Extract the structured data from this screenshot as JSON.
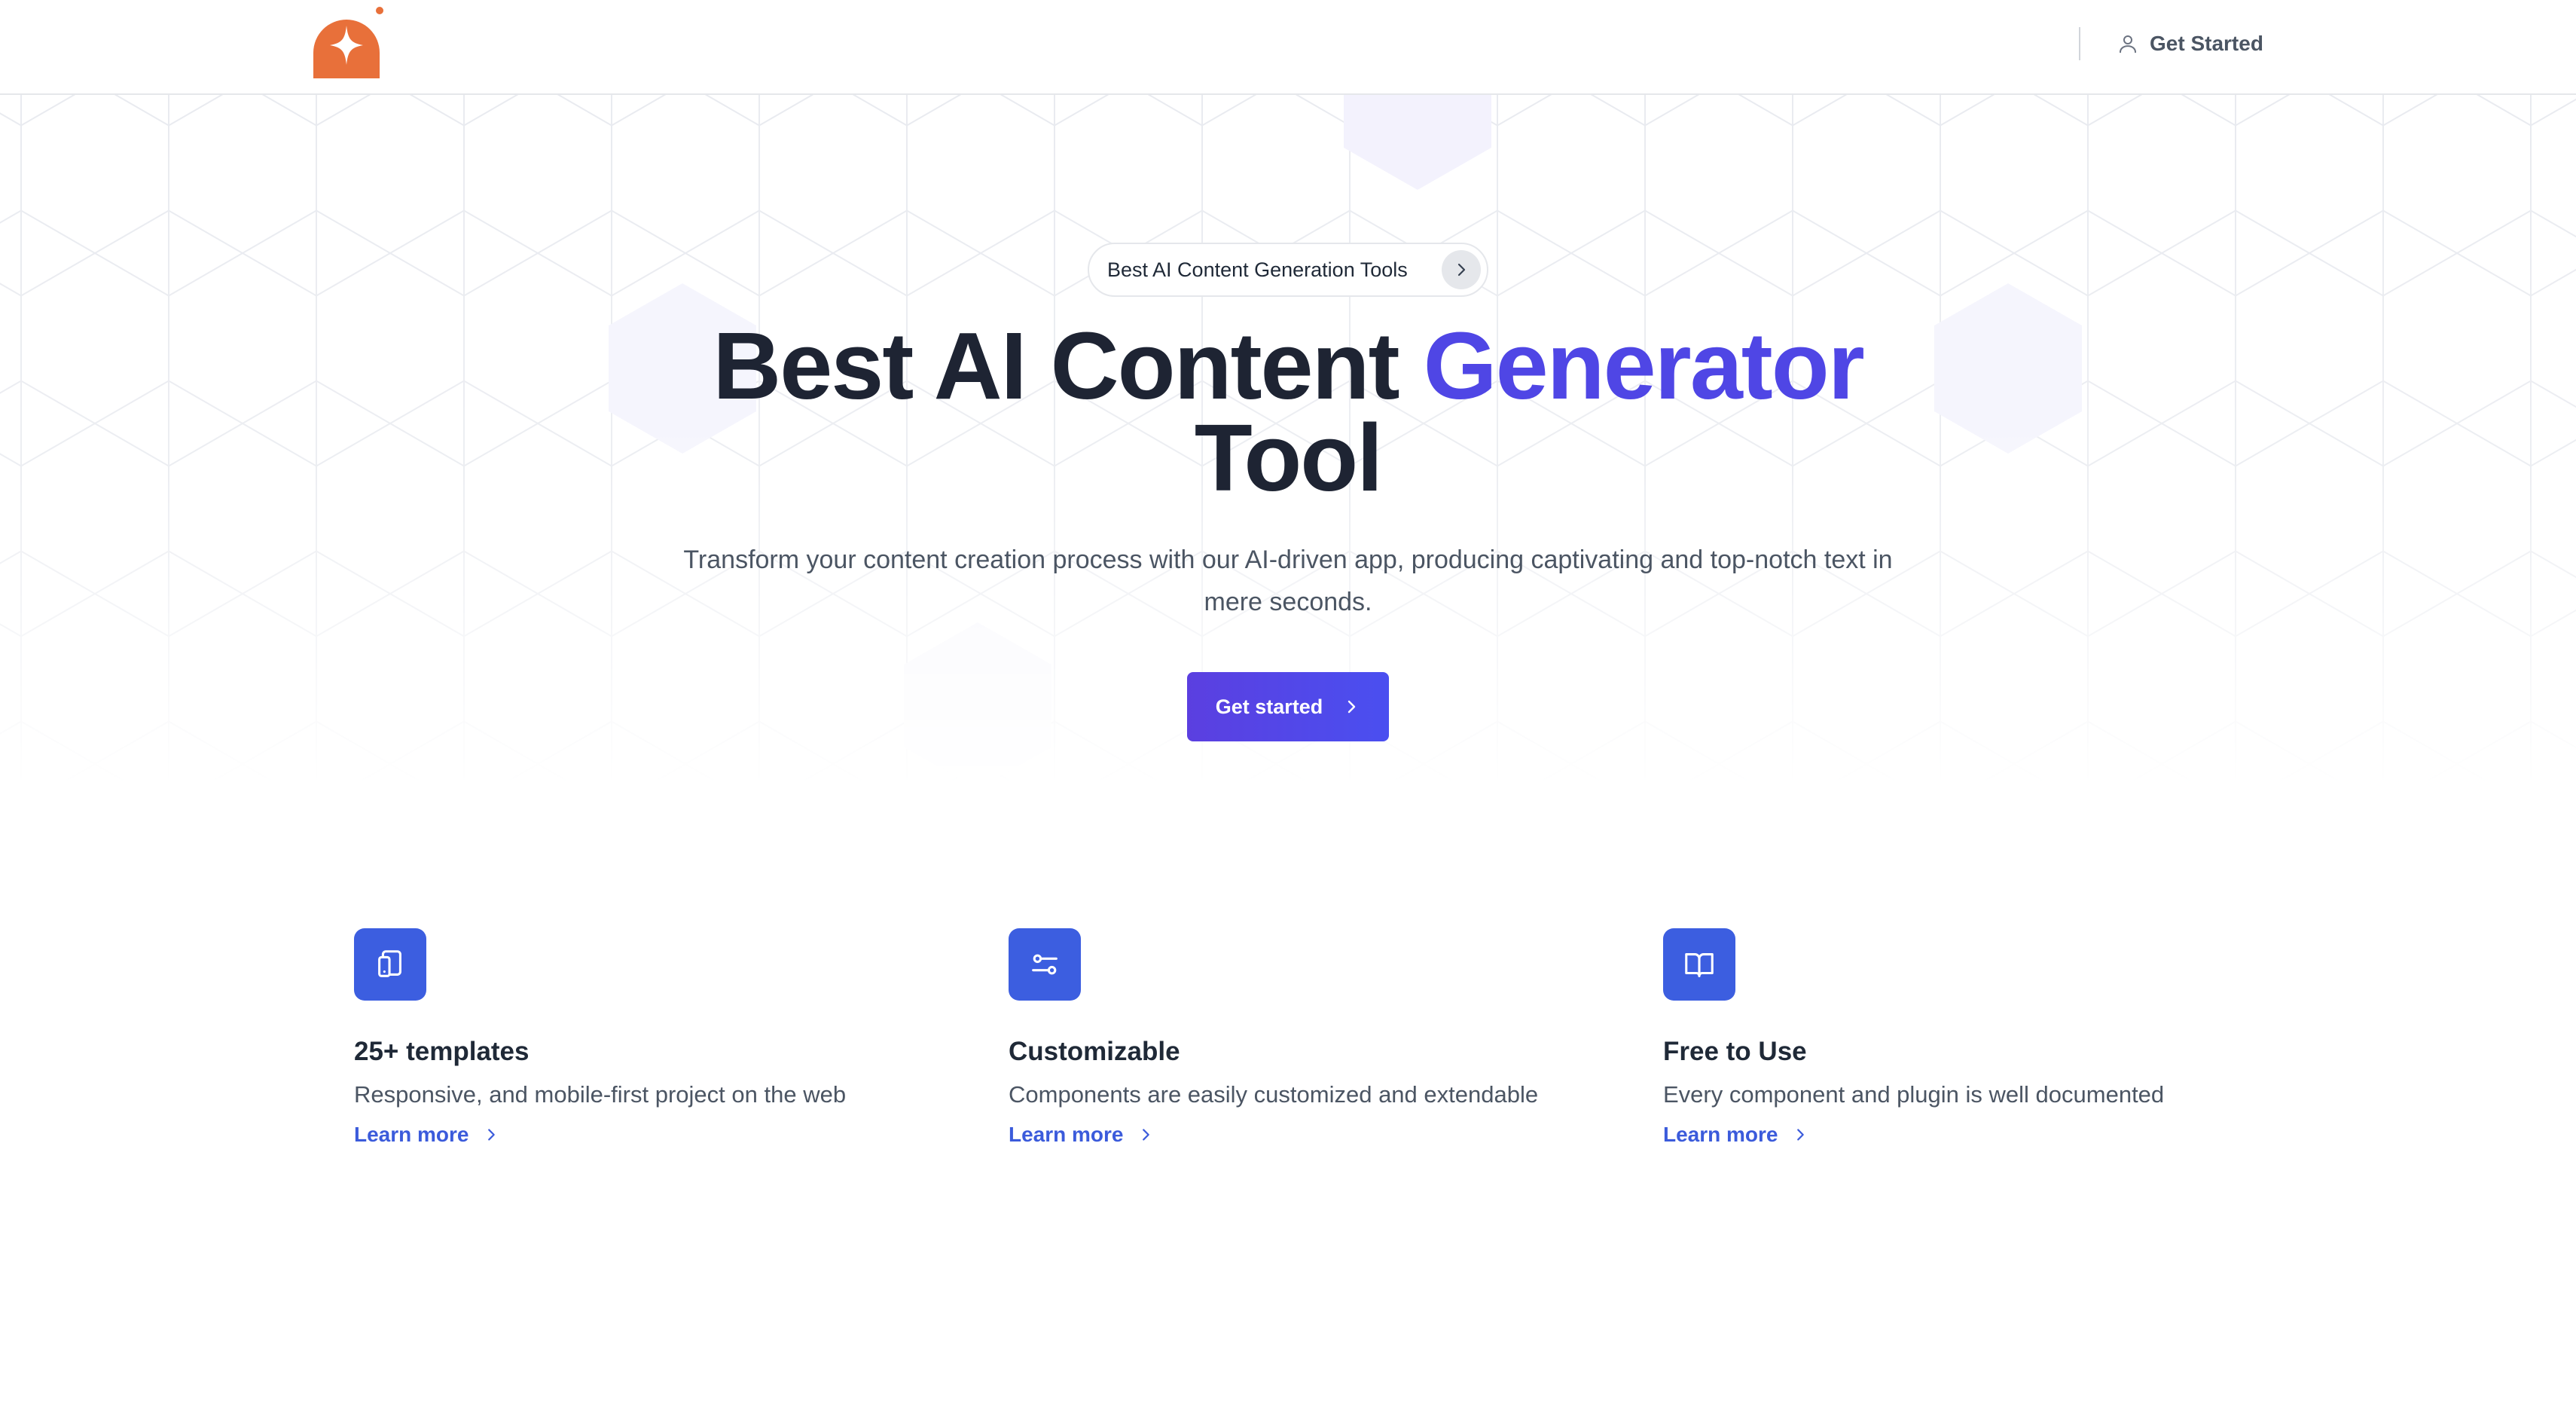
{
  "header": {
    "logo_icon": "sparkle-logo-icon",
    "nav_cta_label": "Get Started",
    "nav_cta_icon": "user-icon"
  },
  "hero": {
    "badge_label": "Best AI Content Generation Tools",
    "badge_icon": "chevron-right-icon",
    "title_part1": "Best AI Content ",
    "title_accent": "Generator",
    "title_part2": "Tool",
    "subtitle": "Transform your content creation process with our AI-driven app, producing captivating and top-notch text in mere seconds.",
    "cta_label": "Get started",
    "cta_icon": "chevron-right-icon"
  },
  "features": [
    {
      "icon": "tablet-icon",
      "title": "25+ templates",
      "description": "Responsive, and mobile-first project on the web",
      "link_label": "Learn more"
    },
    {
      "icon": "sliders-icon",
      "title": "Customizable",
      "description": "Components are easily customized and extendable",
      "link_label": "Learn more"
    },
    {
      "icon": "book-open-icon",
      "title": "Free to Use",
      "description": "Every component and plugin is well documented",
      "link_label": "Learn more"
    }
  ],
  "colors": {
    "brand_orange": "#e8703a",
    "accent_purple": "#4f46e5",
    "feature_icon_blue": "#3c5ee0",
    "link_blue": "#3b5bdb",
    "heading_dark": "#1e2433"
  }
}
